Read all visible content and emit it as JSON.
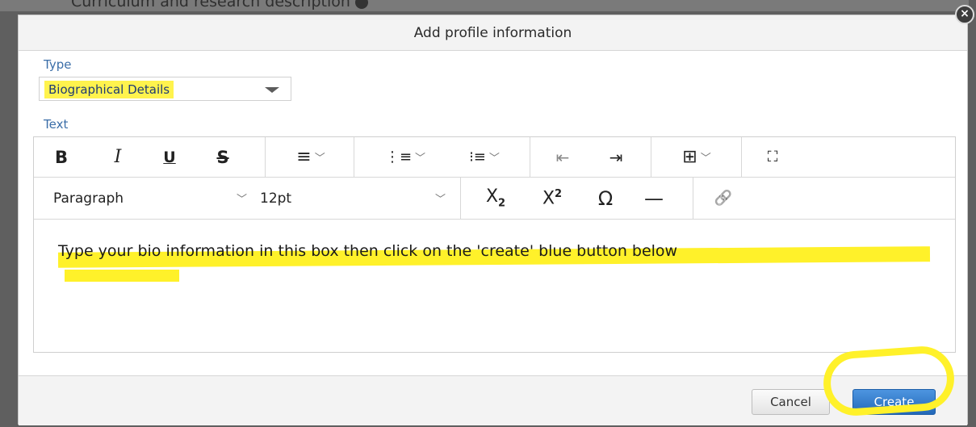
{
  "background": {
    "section_label": "Curriculum and research description"
  },
  "dialog": {
    "title": "Add profile information",
    "close_glyph": "×",
    "type_label": "Type",
    "type_value": "Biographical Details",
    "text_label": "Text",
    "toolbar": {
      "bold": "B",
      "italic": "I",
      "underline": "U",
      "strikethrough": "S",
      "align_glyph": "≡",
      "numbered_list_glyph": "⋮≡",
      "bullet_list_glyph": "⁝≡",
      "outdent_glyph": "⇤",
      "indent_glyph": "⇥",
      "table_glyph": "⊞",
      "fullscreen_glyph": "⛶",
      "chevron": "﹀",
      "block_format": "Paragraph",
      "font_size": "12pt",
      "subscript_base": "X",
      "subscript_index": "2",
      "superscript_base": "X",
      "superscript_index": "2",
      "special_char": "Ω",
      "horizontal_rule": "—",
      "link_glyph": "🔗"
    },
    "content_text": "Type your bio information in this box then click on the 'create' blue button below",
    "cancel_label": "Cancel",
    "create_label": "Create"
  },
  "colors": {
    "highlight": "#fff12a",
    "label_blue": "#3b6ea8",
    "primary_button": "#2368b8"
  }
}
